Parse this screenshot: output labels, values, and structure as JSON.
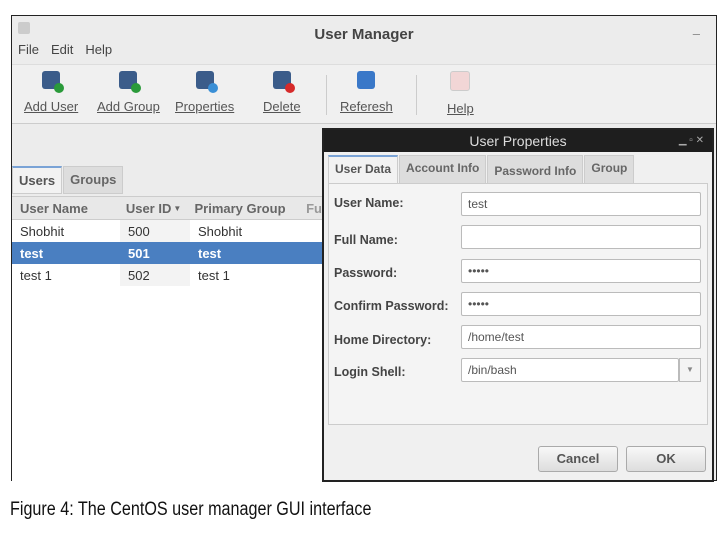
{
  "window": {
    "title": "User Manager"
  },
  "menu": [
    "File",
    "Edit",
    "Help"
  ],
  "toolbar": [
    {
      "label": "Add User",
      "icon": "add-user-icon"
    },
    {
      "label": "Add Group",
      "icon": "add-group-icon"
    },
    {
      "label": "Properties",
      "icon": "properties-icon"
    },
    {
      "label": "Delete",
      "icon": "delete-icon"
    },
    {
      "label": "Referesh",
      "icon": "refresh-icon"
    },
    {
      "label": "Help",
      "icon": "help-icon"
    }
  ],
  "tabs": [
    "Users",
    "Groups"
  ],
  "table": {
    "columns": [
      "User Name",
      "User ID",
      "Primary Group",
      "Fu"
    ],
    "rows": [
      [
        "Shobhit",
        "500",
        "Shobhit"
      ],
      [
        "test",
        "501",
        "test"
      ],
      [
        "test 1",
        "502",
        "test 1"
      ]
    ]
  },
  "dialog": {
    "title": "User Properties",
    "tabs": [
      "User Data",
      "Account Info",
      "Password Info",
      "Group"
    ],
    "fields": [
      {
        "label": "User Name:",
        "value": "test"
      },
      {
        "label": "Full Name:",
        "value": ""
      },
      {
        "label": "Password:",
        "value": "•••••"
      },
      {
        "label": "Confirm Password:",
        "value": "•••••"
      },
      {
        "label": "Home Directory:",
        "value": "/home/test"
      },
      {
        "label": "Login Shell:",
        "value": "/bin/bash"
      }
    ],
    "cancel": "Cancel",
    "ok": "OK"
  },
  "caption": "Figure 4: The CentOS user manager GUI interface"
}
